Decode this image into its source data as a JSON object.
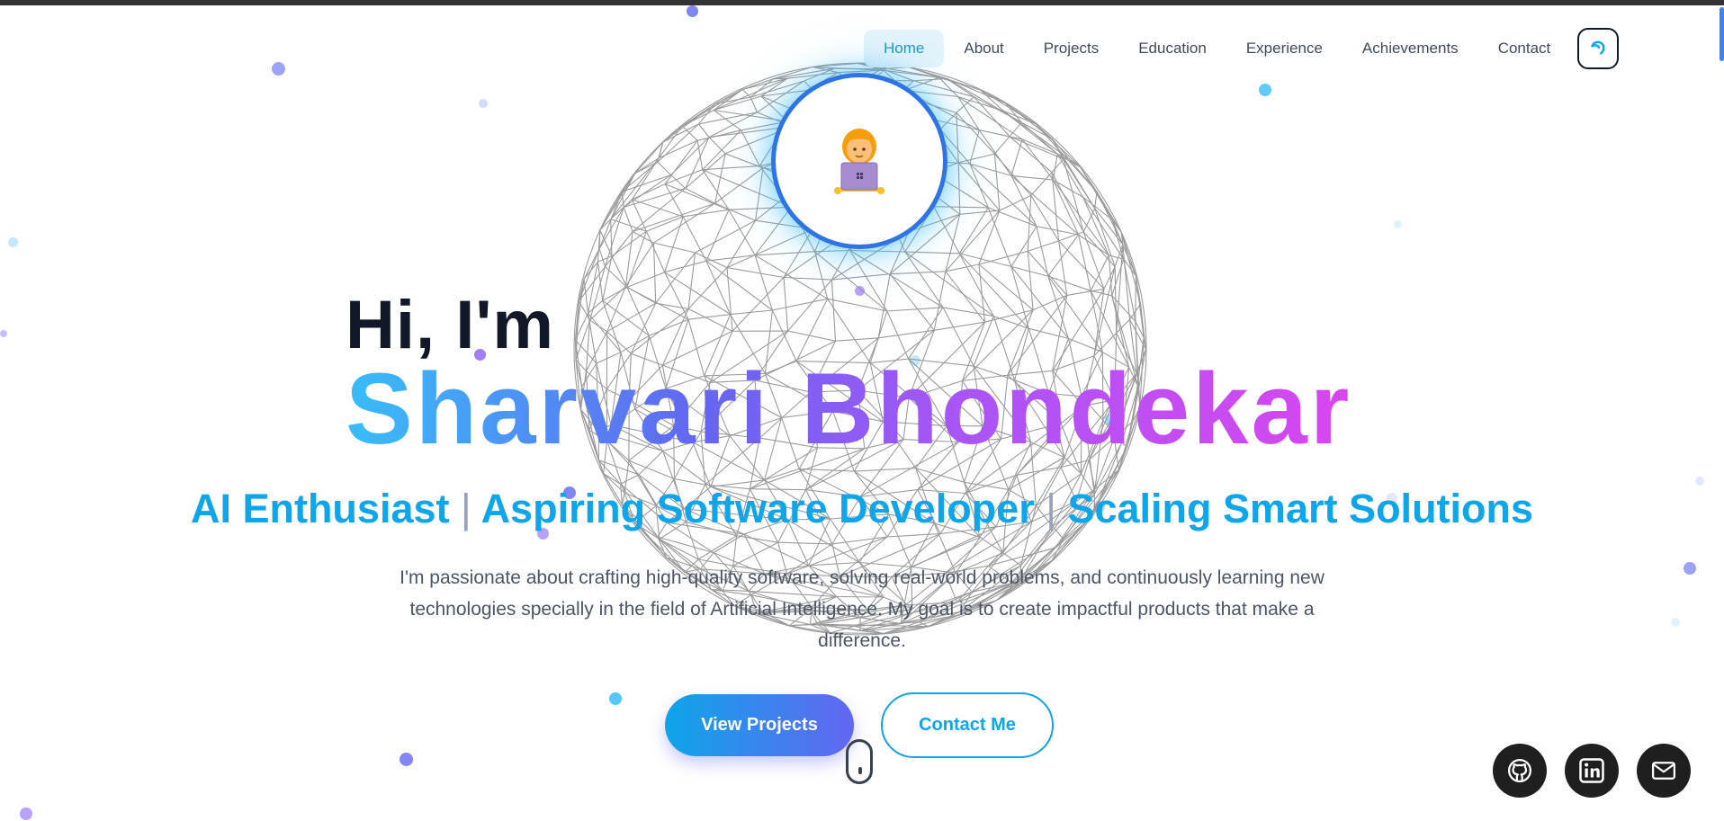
{
  "nav": {
    "items": [
      {
        "label": "Home",
        "active": true
      },
      {
        "label": "About",
        "active": false
      },
      {
        "label": "Projects",
        "active": false
      },
      {
        "label": "Education",
        "active": false
      },
      {
        "label": "Experience",
        "active": false
      },
      {
        "label": "Achievements",
        "active": false
      },
      {
        "label": "Contact",
        "active": false
      }
    ],
    "theme_toggle_icon": "moon-icon"
  },
  "hero": {
    "avatar_icon": "woman-technologist-emoji",
    "greeting": "Hi, I'm",
    "name": "Sharvari Bhondekar",
    "roles": [
      "AI Enthusiast",
      "Aspiring Software Developer",
      "Scaling Smart Solutions"
    ],
    "role_separator": "|",
    "description": "I'm passionate about crafting high-quality software, solving real-world problems, and continuously learning new technologies specially in the field of Artificial Intelligence. My goal is to create impactful products that make a difference.",
    "primary_button": "View Projects",
    "secondary_button": "Contact Me",
    "scroll_icon": "mouse-scroll-icon"
  },
  "social": [
    {
      "name": "github",
      "icon": "github-icon"
    },
    {
      "name": "linkedin",
      "icon": "linkedin-icon"
    },
    {
      "name": "email",
      "icon": "mail-icon"
    }
  ],
  "colors": {
    "accent": "#0ea5e9",
    "indigo": "#6366f1",
    "magenta": "#d946ef",
    "text_dark": "#111827",
    "text_muted": "#4b5563"
  }
}
